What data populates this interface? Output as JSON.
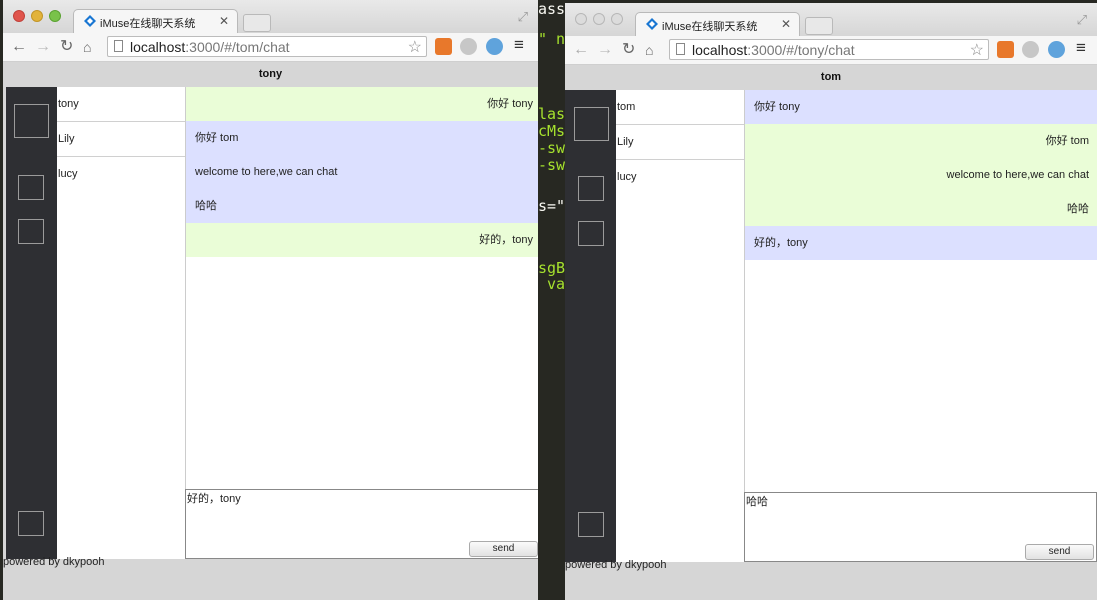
{
  "background_code": [
    "ass=\"   \"",
    "\" ng",
    "lass",
    "cMsg",
    "-swi",
    "-swi",
    "s=\"m",
    "sgBo",
    " val"
  ],
  "windows": [
    {
      "tab_title": "iMuse在线聊天系统",
      "url_host": "localhost",
      "url_rest": ":3000/#/tom/chat",
      "chat_header": "tony",
      "users": [
        "tony",
        "Lily",
        "lucy"
      ],
      "messages_top": [
        {
          "text": "你好 tony",
          "side": "out"
        }
      ],
      "messages_mid": [
        "你好 tom",
        "welcome to here,we can chat",
        "哈哈"
      ],
      "messages_bottom": [
        {
          "text": "好的，tony",
          "side": "out"
        }
      ],
      "composer_text": "好的，tony",
      "send_label": "send",
      "footer": "powered by dkypooh"
    },
    {
      "tab_title": "iMuse在线聊天系统",
      "url_host": "localhost",
      "url_rest": ":3000/#/tony/chat",
      "chat_header": "tom",
      "users": [
        "tom",
        "Lily",
        "lucy"
      ],
      "messages_top": [
        {
          "text": "你好 tony",
          "side": "in"
        }
      ],
      "messages_mid": [
        "你好 tom",
        "welcome to here,we can chat",
        "哈哈"
      ],
      "messages_bottom": [
        {
          "text": "好的，tony",
          "side": "in"
        }
      ],
      "composer_text": "哈哈",
      "send_label": "send",
      "footer": "powered by dkypooh"
    }
  ],
  "colors": {
    "sent_bg": "#eafdd7",
    "received_bg": "#dce0ff",
    "sidebar_bg": "#2e2f33"
  }
}
